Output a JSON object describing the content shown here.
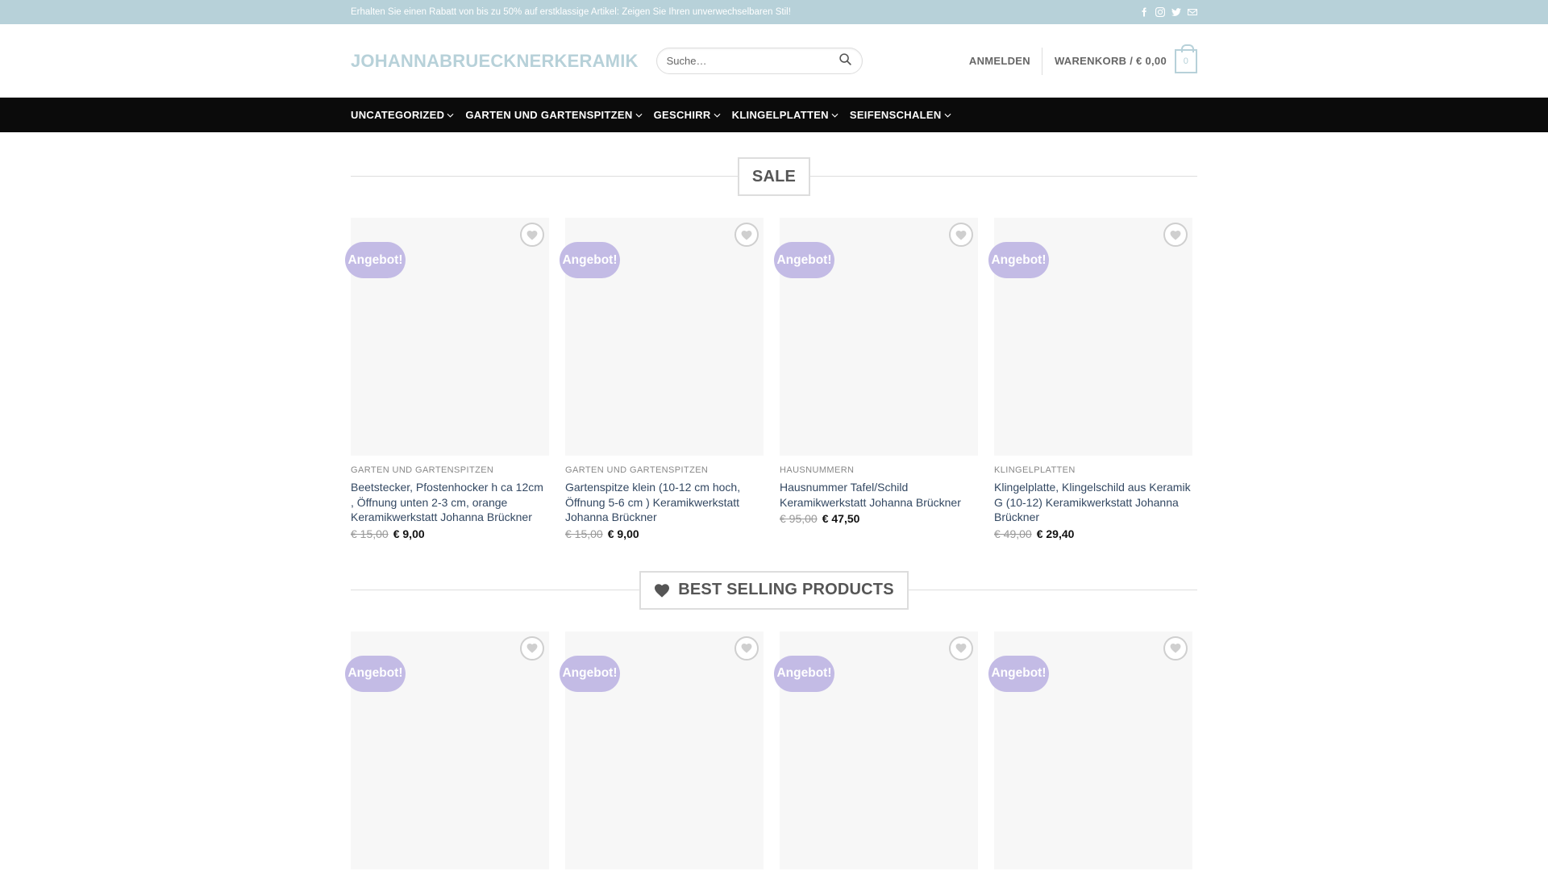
{
  "topbar": {
    "promo": "Erhalten Sie einen Rabatt von bis zu 50% auf erstklassige Artikel: Zeigen Sie Ihren unverwechselbaren Stil!",
    "social_icons": [
      "facebook-icon",
      "instagram-icon",
      "twitter-icon",
      "email-icon"
    ]
  },
  "header": {
    "logo": "JOHANNABRUECKNERKERAMIK",
    "search_placeholder": "Suche…",
    "login": "ANMELDEN",
    "cart_label": "WARENKORB / € 0,00",
    "cart_count": "0"
  },
  "nav": {
    "items": [
      "UNCATEGORIZED",
      "GARTEN UND GARTENSPITZEN",
      "GESCHIRR",
      "KLINGELPLATTEN",
      "SEIFENSCHALEN"
    ]
  },
  "sale": {
    "title": "SALE",
    "products": [
      {
        "badge": "Angebot!",
        "category": "GARTEN UND GARTENSPITZEN",
        "name": "Beetstecker, Pfostenhocker h ca 12cm , Öffnung unten 2-3 cm, orange Keramikwerkstatt Johanna Brückner",
        "old_price": "€ 15,00",
        "price": "€ 9,00"
      },
      {
        "badge": "Angebot!",
        "category": "GARTEN UND GARTENSPITZEN",
        "name": "Gartenspitze klein (10-12 cm hoch, Öffnung 5-6 cm ) Keramikwerkstatt Johanna Brückner",
        "old_price": "€ 15,00",
        "price": "€ 9,00"
      },
      {
        "badge": "Angebot!",
        "category": "HAUSNUMMERN",
        "name": "Hausnummer Tafel/Schild Keramikwerkstatt Johanna Brückner",
        "old_price": "€ 95,00",
        "price": "€ 47,50"
      },
      {
        "badge": "Angebot!",
        "category": "KLINGELPLATTEN",
        "name": "Klingelplatte, Klingelschild aus Keramik G (10-12) Keramikwerkstatt Johanna Brückner",
        "old_price": "€ 49,00",
        "price": "€ 29,40"
      }
    ]
  },
  "best": {
    "title": "BEST SELLING PRODUCTS",
    "products": [
      {
        "badge": "Angebot!"
      },
      {
        "badge": "Angebot!"
      },
      {
        "badge": "Angebot!"
      },
      {
        "badge": "Angebot!"
      }
    ]
  },
  "colors": {
    "topbar": "#b7d1d9",
    "nav": "#0b0b0b",
    "badge": "#c3bbe5",
    "product_link": "#334862"
  }
}
